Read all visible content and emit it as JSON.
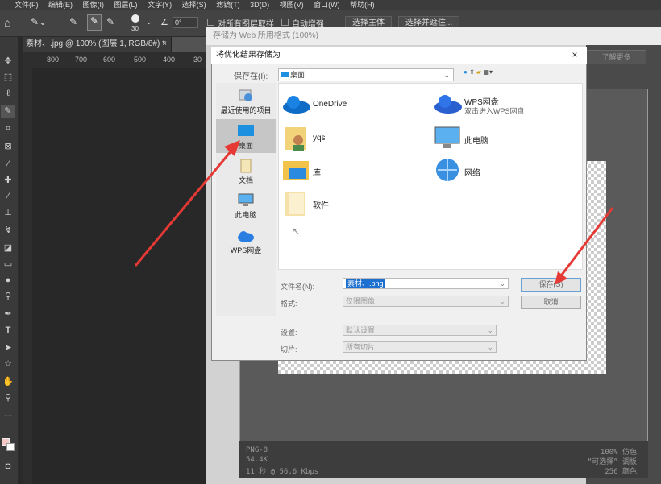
{
  "menubar": [
    "文件(F)",
    "编辑(E)",
    "图像(I)",
    "图层(L)",
    "文字(Y)",
    "选择(S)",
    "滤镜(T)",
    "3D(D)",
    "视图(V)",
    "窗口(W)",
    "帮助(H)"
  ],
  "options": {
    "brush_size": "30",
    "angle": "0°",
    "sample_all_layers": "对所有图层取样",
    "auto_enhance": "自动增强",
    "select_subject": "选择主体",
    "select_and_mask": "选择并遮住..."
  },
  "doc_tab": "素材、.jpg @ 100% (图层 1, RGB/8#) *",
  "doc_tab_close": "×",
  "ruler_ticks": [
    "800",
    "700",
    "600",
    "500",
    "400",
    "30"
  ],
  "save_for_web": {
    "title": "存储为 Web 所用格式 (100%)",
    "learn_more": "了解更多",
    "info_left": [
      "PNG-8",
      "54.4K",
      "11 秒 @ 56.6 Kbps"
    ],
    "info_right": [
      "100% 仿色",
      "“可选择” 调板",
      "256 颜色"
    ]
  },
  "dialog": {
    "title": "将优化结果存储为",
    "close": "×",
    "save_in_label": "保存在(I):",
    "save_in_value": "桌面",
    "places": [
      "最近使用的项目",
      "桌面",
      "文档",
      "此电脑",
      "WPS网盘"
    ],
    "files": [
      {
        "name": "OneDrive",
        "sub": ""
      },
      {
        "name": "WPS网盘",
        "sub": "双击进入WPS网盘"
      },
      {
        "name": "yqs",
        "sub": ""
      },
      {
        "name": "此电脑",
        "sub": ""
      },
      {
        "name": "库",
        "sub": ""
      },
      {
        "name": "网络",
        "sub": ""
      },
      {
        "name": "软件",
        "sub": ""
      }
    ],
    "filename_label": "文件名(N):",
    "filename_value": "素材、.png",
    "format_label": "格式:",
    "format_value": "仅限图像",
    "settings_label": "设置:",
    "settings_value": "默认设置",
    "slices_label": "切片:",
    "slices_value": "所有切片",
    "save_button": "保存(S)",
    "cancel_button": "取消"
  },
  "colors": {
    "accent": "#1e90e0",
    "arrow": "#e53935"
  }
}
